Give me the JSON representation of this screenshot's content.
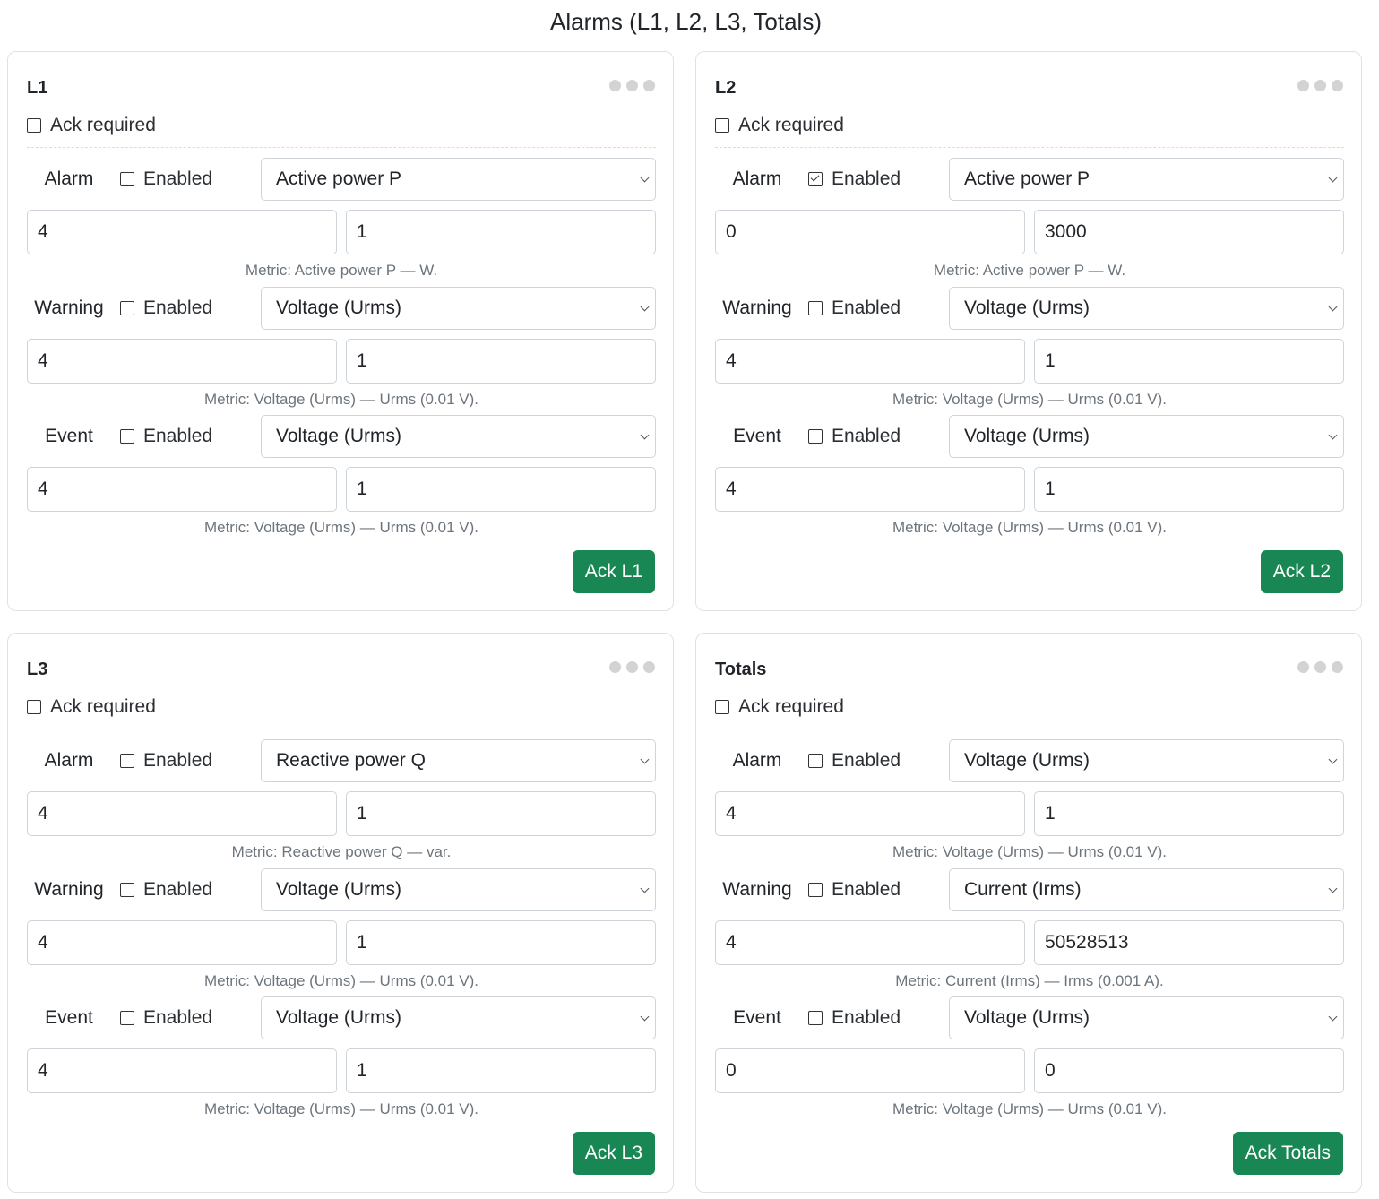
{
  "page_title": "Alarms (L1, L2, L3, Totals)",
  "cards": [
    {
      "title": "L1",
      "ack_required_label": "Ack required",
      "ack_required_checked": false,
      "sections": [
        {
          "label": "Alarm",
          "enabled_label": "Enabled",
          "enabled": false,
          "metric_select": "Active power P",
          "value_a": "4",
          "value_b": "1",
          "metric_note": "Metric: Active power P — W."
        },
        {
          "label": "Warning",
          "enabled_label": "Enabled",
          "enabled": false,
          "metric_select": "Voltage (Urms)",
          "value_a": "4",
          "value_b": "1",
          "metric_note": "Metric: Voltage (Urms) — Urms (0.01 V)."
        },
        {
          "label": "Event",
          "enabled_label": "Enabled",
          "enabled": false,
          "metric_select": "Voltage (Urms)",
          "value_a": "4",
          "value_b": "1",
          "metric_note": "Metric: Voltage (Urms) — Urms (0.01 V)."
        }
      ],
      "ack_button": "Ack L1"
    },
    {
      "title": "L2",
      "ack_required_label": "Ack required",
      "ack_required_checked": false,
      "sections": [
        {
          "label": "Alarm",
          "enabled_label": "Enabled",
          "enabled": true,
          "metric_select": "Active power P",
          "value_a": "0",
          "value_b": "3000",
          "metric_note": "Metric: Active power P — W."
        },
        {
          "label": "Warning",
          "enabled_label": "Enabled",
          "enabled": false,
          "metric_select": "Voltage (Urms)",
          "value_a": "4",
          "value_b": "1",
          "metric_note": "Metric: Voltage (Urms) — Urms (0.01 V)."
        },
        {
          "label": "Event",
          "enabled_label": "Enabled",
          "enabled": false,
          "metric_select": "Voltage (Urms)",
          "value_a": "4",
          "value_b": "1",
          "metric_note": "Metric: Voltage (Urms) — Urms (0.01 V)."
        }
      ],
      "ack_button": "Ack L2"
    },
    {
      "title": "L3",
      "ack_required_label": "Ack required",
      "ack_required_checked": false,
      "sections": [
        {
          "label": "Alarm",
          "enabled_label": "Enabled",
          "enabled": false,
          "metric_select": "Reactive power Q",
          "value_a": "4",
          "value_b": "1",
          "metric_note": "Metric: Reactive power Q — var."
        },
        {
          "label": "Warning",
          "enabled_label": "Enabled",
          "enabled": false,
          "metric_select": "Voltage (Urms)",
          "value_a": "4",
          "value_b": "1",
          "metric_note": "Metric: Voltage (Urms) — Urms (0.01 V)."
        },
        {
          "label": "Event",
          "enabled_label": "Enabled",
          "enabled": false,
          "metric_select": "Voltage (Urms)",
          "value_a": "4",
          "value_b": "1",
          "metric_note": "Metric: Voltage (Urms) — Urms (0.01 V)."
        }
      ],
      "ack_button": "Ack L3"
    },
    {
      "title": "Totals",
      "ack_required_label": "Ack required",
      "ack_required_checked": false,
      "sections": [
        {
          "label": "Alarm",
          "enabled_label": "Enabled",
          "enabled": false,
          "metric_select": "Voltage (Urms)",
          "value_a": "4",
          "value_b": "1",
          "metric_note": "Metric: Voltage (Urms) — Urms (0.01 V)."
        },
        {
          "label": "Warning",
          "enabled_label": "Enabled",
          "enabled": false,
          "metric_select": "Current (Irms)",
          "value_a": "4",
          "value_b": "50528513",
          "metric_note": "Metric: Current (Irms) — Irms (0.001 A)."
        },
        {
          "label": "Event",
          "enabled_label": "Enabled",
          "enabled": false,
          "metric_select": "Voltage (Urms)",
          "value_a": "0",
          "value_b": "0",
          "metric_note": "Metric: Voltage (Urms) — Urms (0.01 V)."
        }
      ],
      "ack_button": "Ack Totals"
    }
  ],
  "colors": {
    "ack_button": "#198754",
    "border": "#dee2e6",
    "muted_text": "#6c757d"
  },
  "icons": {
    "menu": "more-dots-icon",
    "select": "chevron-down-icon",
    "checkbox": "checkbox-icon"
  }
}
